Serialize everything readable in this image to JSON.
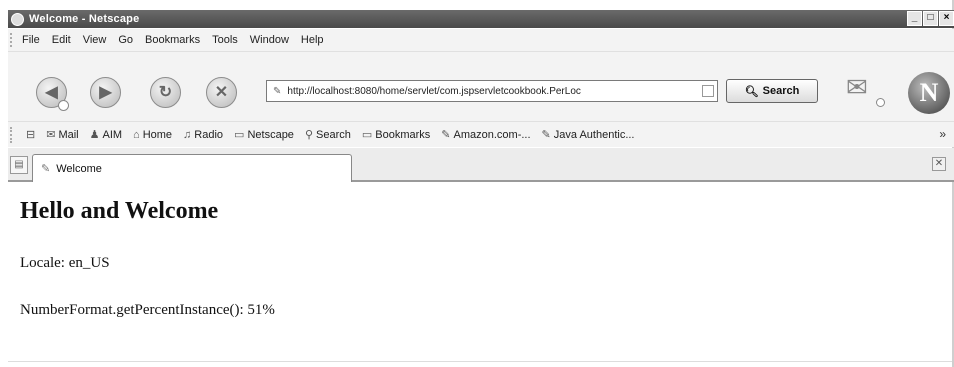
{
  "window": {
    "title": "Welcome - Netscape",
    "controls": [
      "_",
      "□",
      "×"
    ]
  },
  "menu": {
    "items": [
      "File",
      "Edit",
      "View",
      "Go",
      "Bookmarks",
      "Tools",
      "Window",
      "Help"
    ]
  },
  "navigation": {
    "back_icon": "back-arrow-icon",
    "forward_icon": "forward-arrow-icon",
    "reload_icon": "reload-icon",
    "stop_icon": "stop-icon",
    "url": "http://localhost:8080/home/servlet/com.jspservletcookbook.PerLoc",
    "search_label": "Search"
  },
  "personal_toolbar": {
    "items": [
      "Mail",
      "AIM",
      "Home",
      "Radio",
      "Netscape",
      "Search",
      "Bookmarks",
      "Amazon.com-...",
      "Java Authentic..."
    ],
    "more": "»"
  },
  "tabs": [
    {
      "label": "Welcome",
      "active": true
    }
  ],
  "page": {
    "heading": "Hello and Welcome",
    "locale_line": "Locale: en_US",
    "percent_line": "NumberFormat.getPercentInstance(): 51%"
  }
}
